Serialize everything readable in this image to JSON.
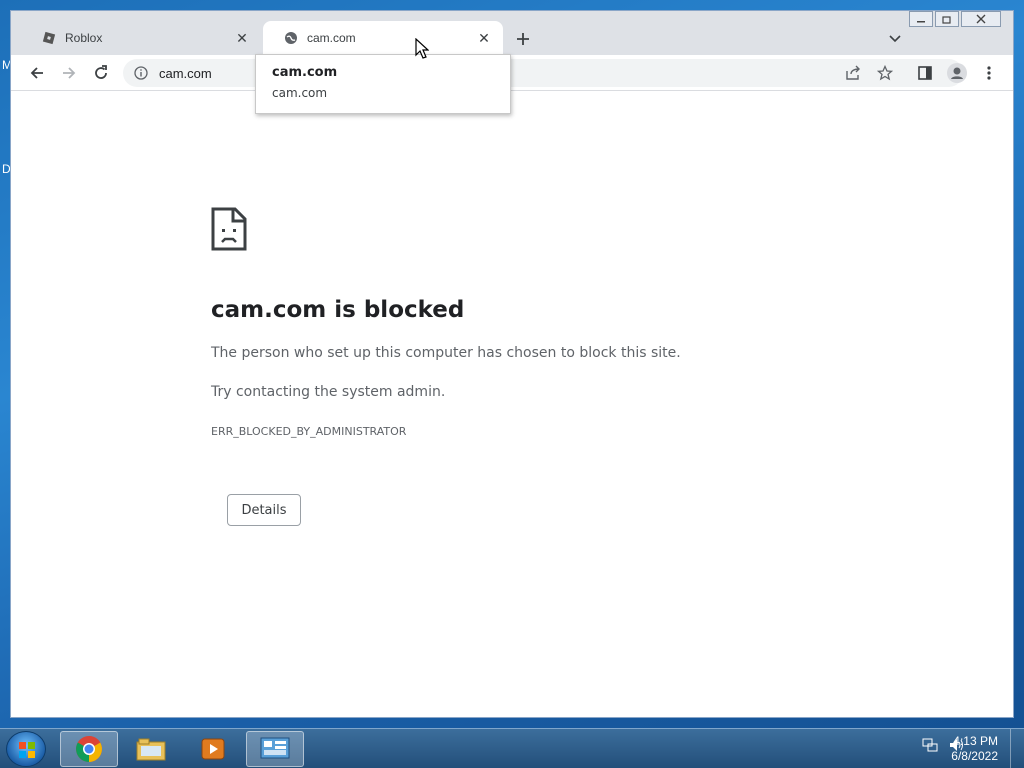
{
  "desktop": {
    "edge_letter_1": "M",
    "edge_letter_2": "D"
  },
  "browser": {
    "tabs": [
      {
        "title": "Roblox",
        "icon": "roblox-icon",
        "active": false
      },
      {
        "title": "cam.com",
        "icon": "globe-icon",
        "active": true
      }
    ],
    "address": "cam.com",
    "hovercard": {
      "title": "cam.com",
      "domain": "cam.com"
    }
  },
  "error_page": {
    "heading": "cam.com is blocked",
    "line1": "The person who set up this computer has chosen to block this site.",
    "line2": "Try contacting the system admin.",
    "code": "ERR_BLOCKED_BY_ADMINISTRATOR",
    "details_label": "Details"
  },
  "taskbar": {
    "items": [
      "chrome-icon",
      "file-explorer-icon",
      "media-player-icon",
      "control-panel-icon"
    ],
    "time": "4:13 PM",
    "date": "6/8/2022"
  },
  "colors": {
    "accent": "#1a73e8",
    "text": "#202124",
    "muted": "#5f6368"
  }
}
